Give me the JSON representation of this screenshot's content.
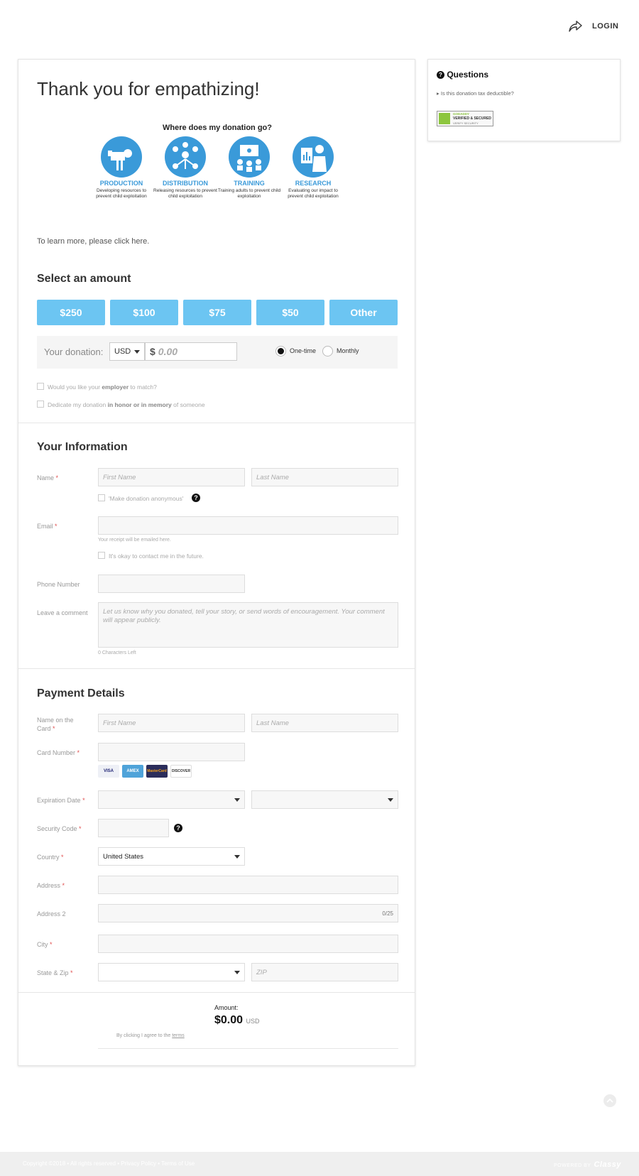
{
  "header": {
    "login_label": "LOGIN"
  },
  "page": {
    "title": "Thank you for empathizing!"
  },
  "infographic": {
    "title": "Where does my donation go?",
    "items": [
      {
        "label": "PRODUCTION",
        "desc": "Developing resources to prevent child exploitation"
      },
      {
        "label": "DISTRIBUTION",
        "desc": "Releasing resources to prevent child exploitation"
      },
      {
        "label": "TRAINING",
        "desc": "Training adults to prevent child exploitation"
      },
      {
        "label": "RESEARCH",
        "desc": "Evaluating our impact to prevent child exploitation"
      }
    ]
  },
  "learn_more": "To learn more, please click here.",
  "amount_section": {
    "title": "Select an amount",
    "options": [
      "$250",
      "$100",
      "$75",
      "$50",
      "Other"
    ],
    "donation_label": "Your donation:",
    "currency": "USD",
    "dollar_sign": "$",
    "amount_placeholder": "0.00",
    "frequency": {
      "one_time": "One-time",
      "monthly": "Monthly",
      "selected": "One-time"
    },
    "employer_match": {
      "pre": "Would you like your ",
      "bold": "employer",
      "post": " to match?"
    },
    "dedicate": {
      "pre": "Dedicate my donation ",
      "bold": "in honor or in memory",
      "post": " of someone"
    }
  },
  "info_section": {
    "title": "Your Information",
    "name_label": "Name",
    "first_name_placeholder": "First Name",
    "last_name_placeholder": "Last Name",
    "anonymous_label": "'Make donation anonymous'",
    "email_label": "Email",
    "email_hint": "Your receipt will be emailed here.",
    "contact_label": "It's okay to contact me in the future.",
    "phone_label": "Phone Number",
    "comment_label": "Leave a comment",
    "comment_placeholder": "Let us know why you donated, tell your story, or send words of encouragement. Your comment will appear publicly.",
    "chars_left": "0 Characters Left"
  },
  "payment_section": {
    "title": "Payment Details",
    "name_on_card_label_1": "Name on the",
    "name_on_card_label_2": "Card",
    "first_name_placeholder": "First Name",
    "last_name_placeholder": "Last Name",
    "card_number_label": "Card Number",
    "cards": [
      "VISA",
      "AMEX",
      "MasterCard",
      "DISCOVER"
    ],
    "expiration_label": "Expiration Date",
    "security_label": "Security Code",
    "country_label": "Country",
    "country_value": "United States",
    "address_label": "Address",
    "address2_label": "Address 2",
    "address2_counter": "0/25",
    "city_label": "City",
    "state_zip_label": "State & Zip",
    "zip_placeholder": "ZIP"
  },
  "summary": {
    "amount_title": "Amount:",
    "amount_value": "$0.00",
    "amount_currency": "USD",
    "terms_pre": "By clicking I agree to the ",
    "terms_link": "terms"
  },
  "sidebar": {
    "title": "Questions",
    "question": "Is this donation tax deductible?",
    "seal_text": "VERIFIED & SECURED",
    "seal_brand": "GODADDY",
    "seal_sub": "VERIFY SECURITY"
  },
  "footer": {
    "text": "Copyright ©2018 • All rights reserved • Privacy Policy • Terms of Use",
    "powered": "POWERED BY",
    "brand": "Classy"
  },
  "colors": {
    "accent": "#6cc5f2",
    "info_blue": "#3a9ad9",
    "required": "#e05050"
  }
}
